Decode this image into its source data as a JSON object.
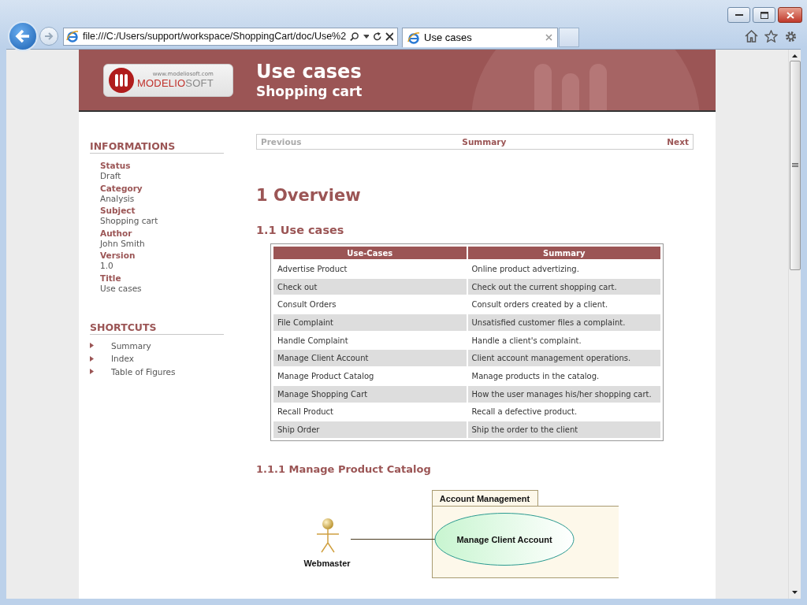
{
  "browser": {
    "address": "file:///C:/Users/support/workspace/ShoppingCart/doc/Use%2",
    "tab_title": "Use cases"
  },
  "header": {
    "logo_parts": [
      "MODELIO",
      "SOFT"
    ],
    "logo_url": "www.modeliosoft.com",
    "title": "Use cases",
    "subtitle": "Shopping cart"
  },
  "sidebar": {
    "info_heading": "INFORMATIONS",
    "info": [
      {
        "label": "Status",
        "value": "Draft"
      },
      {
        "label": "Category",
        "value": "Analysis"
      },
      {
        "label": "Subject",
        "value": "Shopping cart"
      },
      {
        "label": "Author",
        "value": "John Smith"
      },
      {
        "label": "Version",
        "value": "1.0"
      },
      {
        "label": "Title",
        "value": "Use cases"
      }
    ],
    "shortcuts_heading": "SHORTCUTS",
    "shortcuts": [
      "Summary",
      "Index",
      "Table of Figures"
    ]
  },
  "nav": {
    "previous": {
      "label": "Previous",
      "disabled": true
    },
    "summary": "Summary",
    "next": {
      "label": "Next",
      "disabled": false
    }
  },
  "h1": "1 Overview",
  "h2": "1.1 Use cases",
  "table": {
    "columns": [
      "Use-Cases",
      "Summary"
    ],
    "rows": [
      [
        "Advertise Product",
        "Online product advertizing."
      ],
      [
        "Check out",
        "Check out the current shopping cart."
      ],
      [
        "Consult Orders",
        "Consult orders created by a client."
      ],
      [
        "File Complaint",
        "Unsatisfied customer files a complaint."
      ],
      [
        "Handle Complaint",
        "Handle a client's complaint."
      ],
      [
        "Manage Client Account",
        "Client account management operations."
      ],
      [
        "Manage Product Catalog",
        "Manage products in the catalog."
      ],
      [
        "Manage Shopping Cart",
        "How the user manages his/her shopping cart."
      ],
      [
        "Recall Product",
        "Recall a defective product."
      ],
      [
        "Ship Order",
        "Ship the order to the client"
      ]
    ]
  },
  "h3": "1.1.1 Manage Product Catalog",
  "diagram": {
    "package": "Account Management",
    "use_case": "Manage Client Account",
    "actor": "Webmaster"
  }
}
